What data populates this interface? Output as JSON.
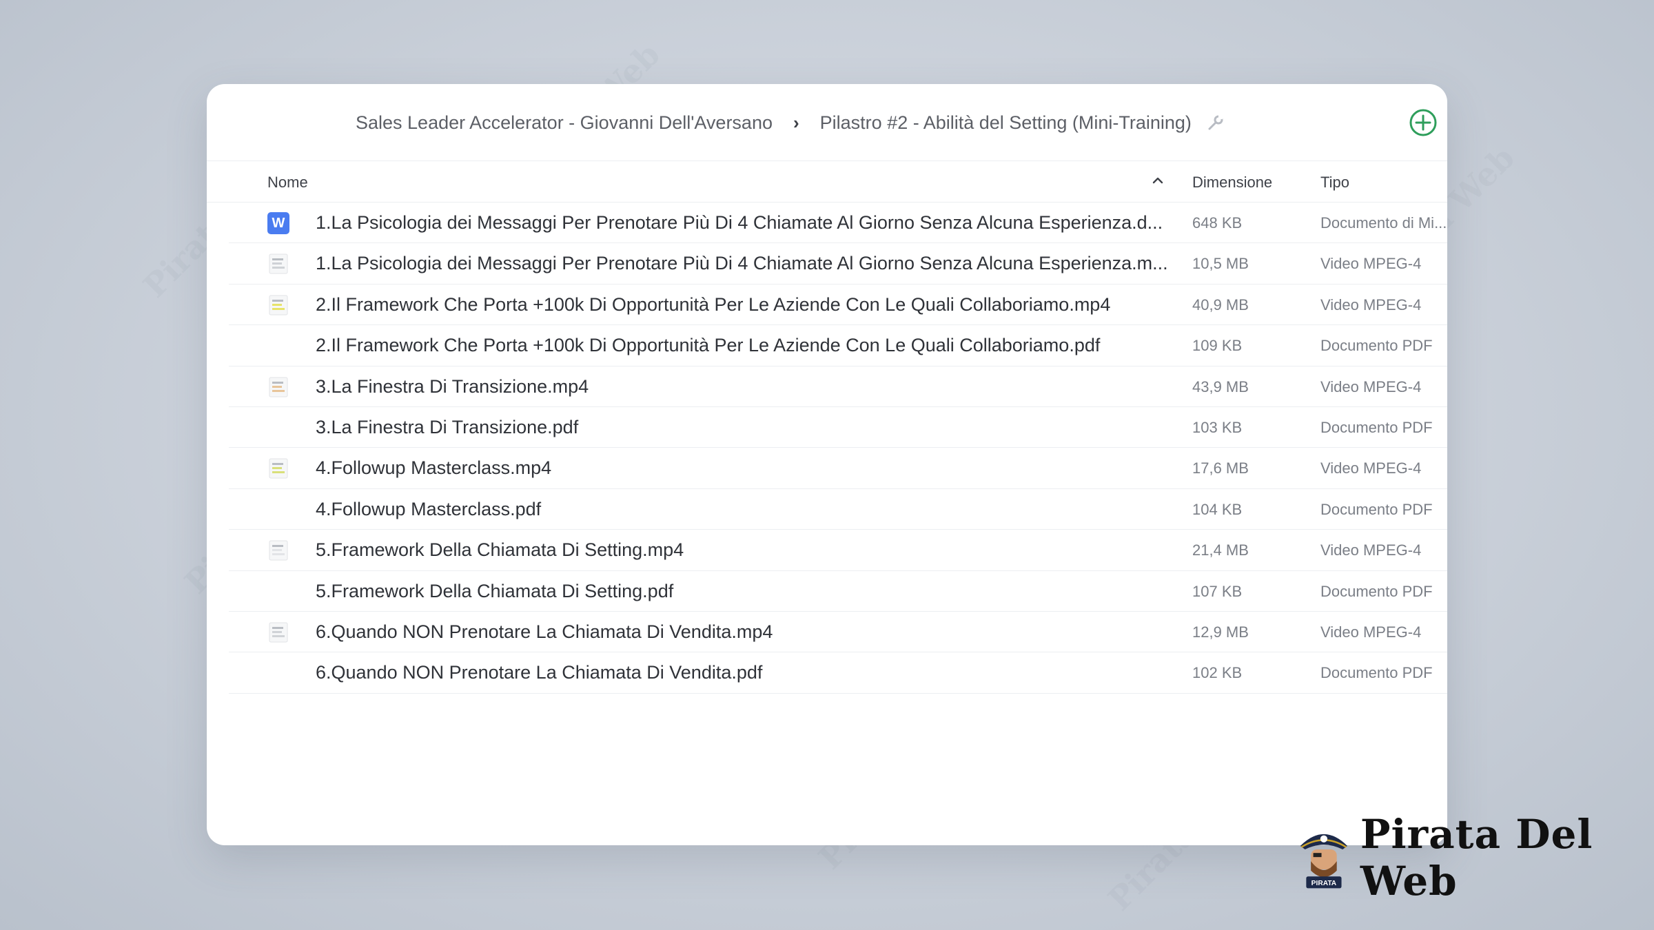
{
  "breadcrumb": {
    "root": "Sales Leader Accelerator - Giovanni Dell'Aversano",
    "current": "Pilastro #2 - Abilità del Setting (Mini-Training)"
  },
  "columns": {
    "name": "Nome",
    "size": "Dimensione",
    "type": "Tipo"
  },
  "files": [
    {
      "icon": "word-doc-icon",
      "name": "1.La Psicologia dei Messaggi Per Prenotare Più Di 4 Chiamate Al Giorno Senza Alcuna Esperienza.d...",
      "size": "648 KB",
      "type": "Documento di Mi..."
    },
    {
      "icon": "video-thumbnail-icon",
      "name": "1.La Psicologia dei Messaggi Per Prenotare Più Di 4 Chiamate Al Giorno Senza Alcuna Esperienza.m...",
      "size": "10,5 MB",
      "type": "Video MPEG-4"
    },
    {
      "icon": "video-thumbnail-icon",
      "name": "2.Il Framework Che Porta +100k Di Opportunità Per Le Aziende Con Le Quali Collaboriamo.mp4",
      "size": "40,9 MB",
      "type": "Video MPEG-4"
    },
    {
      "icon": "pdf-icon",
      "name": "2.Il Framework Che Porta +100k Di Opportunità Per Le Aziende Con Le Quali Collaboriamo.pdf",
      "size": "109 KB",
      "type": "Documento PDF"
    },
    {
      "icon": "video-thumbnail-icon",
      "name": "3.La Finestra Di Transizione.mp4",
      "size": "43,9 MB",
      "type": "Video MPEG-4"
    },
    {
      "icon": "pdf-icon",
      "name": "3.La Finestra Di Transizione.pdf",
      "size": "103 KB",
      "type": "Documento PDF"
    },
    {
      "icon": "video-thumbnail-icon",
      "name": "4.Followup Masterclass.mp4",
      "size": "17,6 MB",
      "type": "Video MPEG-4"
    },
    {
      "icon": "pdf-icon",
      "name": "4.Followup Masterclass.pdf",
      "size": "104 KB",
      "type": "Documento PDF"
    },
    {
      "icon": "video-thumbnail-icon",
      "name": "5.Framework Della Chiamata Di Setting.mp4",
      "size": "21,4 MB",
      "type": "Video MPEG-4"
    },
    {
      "icon": "pdf-icon",
      "name": "5.Framework Della Chiamata Di Setting.pdf",
      "size": "107 KB",
      "type": "Documento PDF"
    },
    {
      "icon": "video-thumbnail-icon",
      "name": "6.Quando NON Prenotare La Chiamata Di Vendita.mp4",
      "size": "12,9 MB",
      "type": "Video MPEG-4"
    },
    {
      "icon": "pdf-icon",
      "name": "6.Quando NON Prenotare La Chiamata Di Vendita.pdf",
      "size": "102 KB",
      "type": "Documento PDF"
    }
  ],
  "brand": {
    "name": "Pirata Del Web",
    "badge": "PIRATA"
  },
  "colors": {
    "accent_add": "#2e9e5b",
    "word_blue": "#4a7cf0"
  }
}
